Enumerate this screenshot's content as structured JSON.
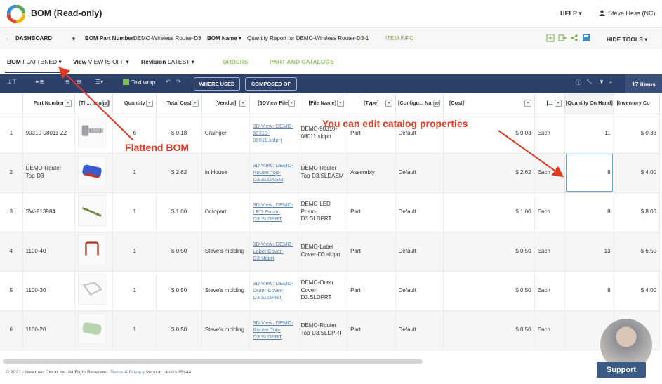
{
  "app": {
    "title": "BOM (Read-only)"
  },
  "header": {
    "help_label": "HELP ▾",
    "user_name": "Steve Hess (NC)"
  },
  "breadcrumb": {
    "back_label": "DASHBOARD",
    "part_number_label": "BOM Part Number:",
    "part_number_value": "DEMO-Wireless Router-D3",
    "bom_name_label": "BOM Name ▾",
    "bom_name_value": "Quantity Report for DEMO-Wireless Router-D3-1",
    "item_info_label": "ITEM INFO",
    "hide_tools_label": "HIDE TOOLS ▾"
  },
  "options": {
    "bom_label": "BOM",
    "bom_value": "FLATTENED ▾",
    "view_label": "View",
    "view_value": "VIEW IS OFF ▾",
    "revision_label": "Revision",
    "revision_value": "LATEST ▾",
    "tab_orders": "ORDERS",
    "tab_parts": "PART AND CATALOGS"
  },
  "toolbar": {
    "text_wrap": "Text wrap",
    "where_used": "WHERE USED",
    "composed_of": "COMPOSED OF",
    "items_count": "17 items"
  },
  "table": {
    "headers": [
      "",
      "Part Number",
      "[Th... image]",
      "Quantity",
      "Total Cost",
      "[Vendor]",
      "[3DView File]",
      "[File Name]",
      "[Type]",
      "[Configu... Name]",
      "[Cost]",
      "[...",
      "[Quantity On Hand]",
      "[Inventory Co"
    ],
    "rows": [
      {
        "n": "1",
        "part": "90310-08011-ZZ",
        "qty": "6",
        "total": "$ 0.18",
        "vendor": "Grainger",
        "view": "3D View: DEMO-90310-08011.sldprt",
        "file": "DEMO-90310-08011.sldprt",
        "type": "Part",
        "config": "Default",
        "cost": "$ 0.03",
        "unit": "Each",
        "onhand": "11",
        "inv": "$ 0.33"
      },
      {
        "n": "2",
        "part": "DEMO-Router Top-D3",
        "qty": "1",
        "total": "$ 2.62",
        "vendor": "In House",
        "view": "3D View: DEMO-Router Top-D3.SLDASM",
        "file": "DEMO-Router Top-D3.SLDASM",
        "type": "Assembly",
        "config": "Default",
        "cost": "$ 2.62",
        "unit": "Each",
        "onhand": "8",
        "inv": "$ 4.00"
      },
      {
        "n": "3",
        "part": "SW-913984",
        "qty": "1",
        "total": "$ 1.00",
        "vendor": "Octopart",
        "view": "3D View: DEMO-LED Prism-D3.SLDPRT",
        "file": "DEMO-LED Prism-D3.SLDPRT",
        "type": "Part",
        "config": "Default",
        "cost": "$ 1.00",
        "unit": "Each",
        "onhand": "8",
        "inv": "$ 8.00"
      },
      {
        "n": "4",
        "part": "1100-40",
        "qty": "1",
        "total": "$ 0.50",
        "vendor": "Steve's molding",
        "view": "3D View: DEMO-Label Cover-D3.sldprt",
        "file": "DEMO-Label Cover-D3.sldprt",
        "type": "Part",
        "config": "Default",
        "cost": "$ 0.50",
        "unit": "Each",
        "onhand": "13",
        "inv": "$ 6.50"
      },
      {
        "n": "5",
        "part": "1100-30",
        "qty": "1",
        "total": "$ 0.50",
        "vendor": "Steve's molding",
        "view": "3D View: DEMO-Outer Cover-D3.SLDPRT",
        "file": "DEMO-Outer Cover-D3.SLDPRT",
        "type": "Part",
        "config": "Default",
        "cost": "$ 0.50",
        "unit": "Each",
        "onhand": "8",
        "inv": "$ 4.00"
      },
      {
        "n": "6",
        "part": "1100-20",
        "qty": "1",
        "total": "$ 0.50",
        "vendor": "Steve's molding",
        "view": "3D View: DEMO-Router Top-D3.SLDPRT",
        "file": "DEMO-Router Top-D3.SLDPRT",
        "type": "Part",
        "config": "Default",
        "cost": "$ 0.50",
        "unit": "Each",
        "onhand": "",
        "inv": ""
      }
    ]
  },
  "annotations": {
    "flattened": "Flattend BOM",
    "catalog": "You can edit catalog properties"
  },
  "footer": {
    "copyright": "© 2021 - Newman Cloud Inc. All Right Reserved.",
    "terms": "Terms",
    "amp": "&",
    "privacy": "Privacy",
    "version": "Version: -build-15144"
  },
  "support_label": "Support",
  "colors": {
    "toolbar": "#2d4069",
    "accent_green": "#7ea94a",
    "annotation_red": "#e03a24"
  }
}
